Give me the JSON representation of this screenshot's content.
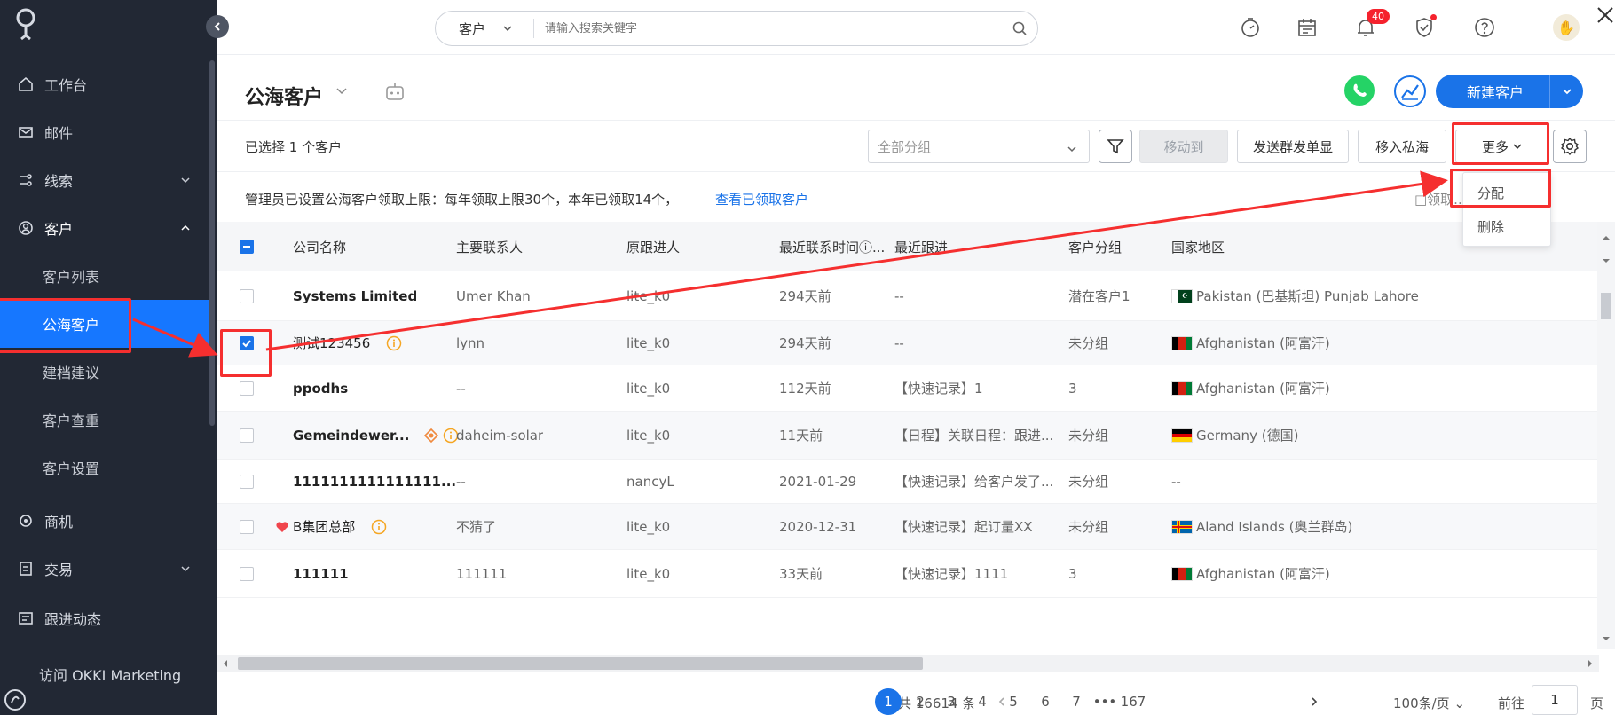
{
  "sidebar": {
    "items": [
      {
        "label": "工作台",
        "icon": "home-icon"
      },
      {
        "label": "邮件",
        "icon": "mail-icon"
      },
      {
        "label": "线索",
        "icon": "leads-icon"
      },
      {
        "label": "客户",
        "icon": "customer-icon"
      },
      {
        "label": "商机",
        "icon": "opportunity-icon"
      },
      {
        "label": "交易",
        "icon": "deal-icon"
      },
      {
        "label": "跟进动态",
        "icon": "followup-icon"
      }
    ],
    "sub_items": [
      "客户列表",
      "公海客户",
      "建档建议",
      "客户查重",
      "客户设置"
    ],
    "active_sub": "公海客户",
    "footer": "访问 OKKI Marketing"
  },
  "topbar": {
    "search_scope": "客户",
    "search_placeholder": "请输入搜索关键字",
    "bell_badge": "40",
    "icons": [
      "timer-icon",
      "calendar-icon",
      "bell-icon",
      "shield-icon",
      "help-icon",
      "avatar",
      "close-icon"
    ]
  },
  "header": {
    "title": "公海客户",
    "new_button": "新建客户"
  },
  "toolbar": {
    "selected_text": "已选择 1 个客户",
    "group_placeholder": "全部分组",
    "move_to": "移动到",
    "broadcast": "发送群发单显",
    "move_private": "移入私海",
    "more": "更多"
  },
  "dropdown": {
    "assign": "分配",
    "delete": "删除"
  },
  "notice": {
    "text": "管理员已设置公海客户领取上限：每年领取上限30个，本年已领取14个，",
    "link": "查看已领取客户",
    "right_partial": "□领取... 上限?"
  },
  "table": {
    "columns": [
      "公司名称",
      "主要联系人",
      "原跟进人",
      "最近联系时间ⓘ...",
      "最近跟进",
      "客户分组",
      "国家地区"
    ],
    "rows": [
      {
        "company": "Systems Limited",
        "contact": "Umer Khan",
        "owner": "lite_k0",
        "last_contact": "294天前",
        "last_follow": "--",
        "group": "潜在客户1",
        "country": "Pakistan (巴基斯坦) Punjab Lahore",
        "flag": "pk",
        "checked": false,
        "info": false,
        "heart": false,
        "bold": true
      },
      {
        "company": "测试123456",
        "contact": "lynn",
        "owner": "lite_k0",
        "last_contact": "294天前",
        "last_follow": "--",
        "group": "未分组",
        "country": "Afghanistan (阿富汗)",
        "flag": "af",
        "checked": true,
        "info": true,
        "heart": false,
        "bold": false
      },
      {
        "company": "ppodhs",
        "contact": "--",
        "owner": "lite_k0",
        "last_contact": "112天前",
        "last_follow": "【快速记录】1",
        "group": "3",
        "country": "Afghanistan (阿富汗)",
        "flag": "af",
        "checked": false,
        "info": false,
        "heart": false,
        "bold": true
      },
      {
        "company": "Gemeindewer...",
        "contact": "daheim-solar",
        "owner": "lite_k0",
        "last_contact": "11天前",
        "last_follow": "【日程】关联日程：跟进...",
        "group": "未分组",
        "country": "Germany (德国)",
        "flag": "de",
        "checked": false,
        "info": true,
        "target": true,
        "heart": false,
        "bold": true
      },
      {
        "company": "1111111111111111...",
        "contact": "--",
        "owner": "nancyL",
        "last_contact": "2021-01-29",
        "last_follow": "【快速记录】给客户发了...",
        "group": "未分组",
        "country": "--",
        "flag": "",
        "checked": false,
        "info": false,
        "heart": false,
        "bold": true
      },
      {
        "company": "B集团总部",
        "contact": "不猜了",
        "owner": "lite_k0",
        "last_contact": "2020-12-31",
        "last_follow": "【快速记录】起订量XX",
        "group": "未分组",
        "country": "Aland Islands (奥兰群岛)",
        "flag": "ax",
        "checked": false,
        "info": true,
        "heart": true,
        "bold": false
      },
      {
        "company": "111111",
        "contact": "111111",
        "owner": "lite_k0",
        "last_contact": "33天前",
        "last_follow": "【快速记录】1111",
        "group": "3",
        "country": "Afghanistan (阿富汗)",
        "flag": "af",
        "checked": false,
        "info": false,
        "heart": false,
        "bold": true
      }
    ]
  },
  "pagination": {
    "total": "共 16614 条",
    "pages": [
      "1",
      "2",
      "3",
      "4",
      "5",
      "6",
      "7",
      "•••",
      "167"
    ],
    "current": "1",
    "per_page": "100条/页",
    "goto_label": "前往",
    "goto_value": "1",
    "page_unit": "页"
  },
  "colors": {
    "primary": "#1a73e8",
    "sidebar_bg": "#222834",
    "annotation_red": "#f52f2f",
    "badge_red": "#f5222d"
  }
}
